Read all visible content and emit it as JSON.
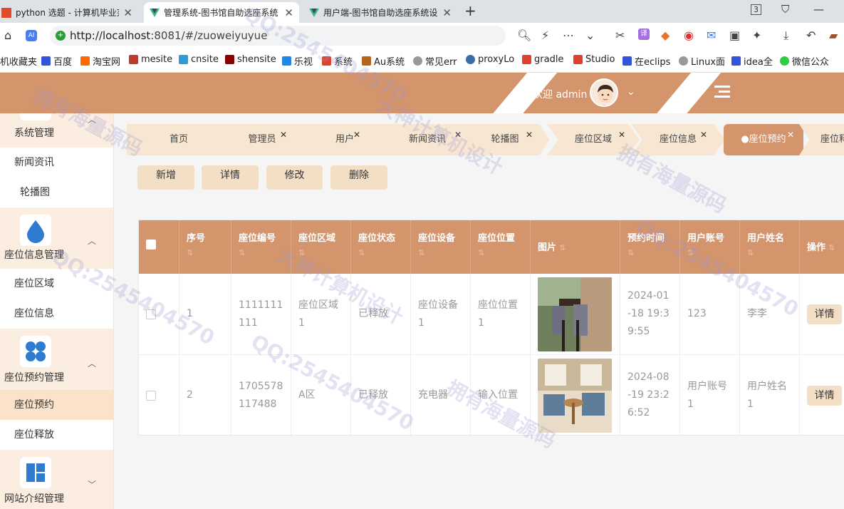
{
  "browser": {
    "tabs": [
      {
        "title": "python 选题 - 计算机毕业范例",
        "active": false
      },
      {
        "title": "管理系统-图书馆自助选座系统",
        "active": true
      },
      {
        "title": "用户端-图书馆自助选座系统设",
        "active": false
      }
    ],
    "url_host": "http://localhost",
    "url_rest": ":8081/#/zuoweiyuyue",
    "bookmarks": [
      "机收藏夹",
      "百度",
      "淘宝网",
      "mesite",
      "cnsite",
      "shensite",
      "乐视",
      "系统",
      "Au系统",
      "常见err",
      "proxyLo",
      "gradle",
      "Studio",
      "在eclips",
      "Linux面",
      "idea全",
      "微信公众"
    ]
  },
  "header": {
    "welcome": "欢迎 admin",
    "color": "#d4956d"
  },
  "sidebar": {
    "groups": [
      {
        "title": "系统管理",
        "items": [
          "新闻资讯",
          "轮播图"
        ]
      },
      {
        "title": "座位信息管理",
        "items": [
          "座位区域",
          "座位信息"
        ]
      },
      {
        "title": "座位预约管理",
        "items": [
          "座位预约",
          "座位释放"
        ]
      },
      {
        "title": "网站介绍管理",
        "items": []
      }
    ]
  },
  "tags": [
    "首页",
    "管理员",
    "用户",
    "新闻资讯",
    "轮播图",
    "座位区域",
    "座位信息",
    "●座位预约",
    "座位释"
  ],
  "actions": {
    "add": "新增",
    "detail": "详情",
    "edit": "修改",
    "delete": "删除"
  },
  "table": {
    "columns": [
      "序号",
      "座位编号",
      "座位区域",
      "座位状态",
      "座位设备",
      "座位位置",
      "图片",
      "预约时间",
      "用户账号",
      "用户姓名",
      "操作"
    ],
    "rows": [
      {
        "index": "1",
        "seat_no": "1111111111",
        "area": "座位区域1",
        "status": "已释放",
        "device": "座位设备1",
        "position": "座位位置1",
        "time": "2024-01-18 19:39:55",
        "account": "123",
        "name": "李李",
        "op": "详情"
      },
      {
        "index": "2",
        "seat_no": "1705578117488",
        "area": "A区",
        "status": "已释放",
        "device": "充电器",
        "position": "输入位置",
        "time": "2024-08-19 23:26:52",
        "account": "用户账号1",
        "name": "用户姓名1",
        "op": "详情"
      }
    ]
  },
  "watermarks": [
    "QQ:2545404570",
    "大神计算机设计",
    "拥有海量源码"
  ]
}
